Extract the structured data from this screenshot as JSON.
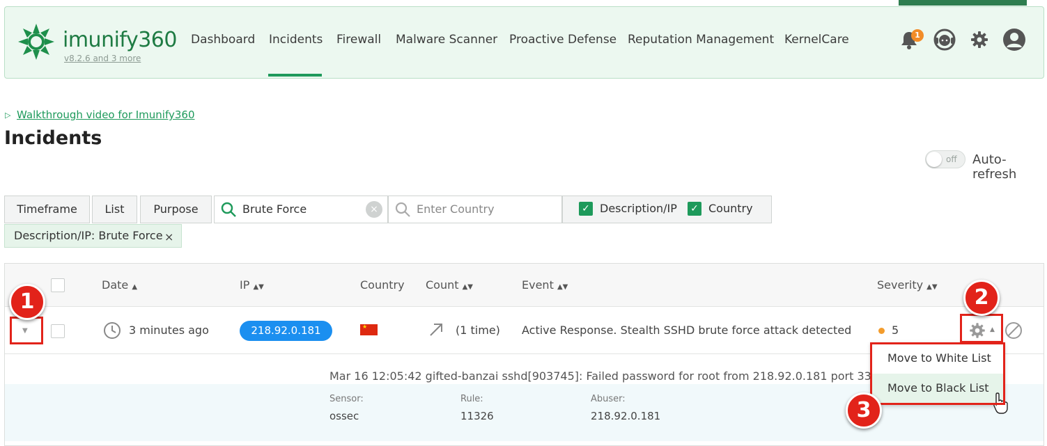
{
  "app": {
    "logo_text": "imunify360",
    "version_link": "v8.2.6 and 3 more"
  },
  "nav": {
    "items": [
      "Dashboard",
      "Incidents",
      "Firewall",
      "Malware Scanner",
      "Proactive Defense",
      "Reputation Management",
      "KernelCare"
    ],
    "active": "Incidents"
  },
  "header_icons": {
    "notifications_count": "1"
  },
  "walkthrough": {
    "link_text": "Walkthrough video for Imunify360"
  },
  "page": {
    "title": "Incidents"
  },
  "auto_refresh": {
    "label": "Auto-refresh",
    "state_text": "off"
  },
  "filters": {
    "buttons": [
      "Timeframe",
      "List",
      "Purpose"
    ],
    "search_value": "Brute Force",
    "country_placeholder": "Enter Country",
    "check_labels": [
      "Description/IP",
      "Country"
    ],
    "active_chip": "Description/IP:  Brute Force",
    "chip_remove": "×"
  },
  "table": {
    "headers": {
      "date": "Date",
      "ip": "IP",
      "country": "Country",
      "count": "Count",
      "event": "Event",
      "severity": "Severity"
    },
    "rows": [
      {
        "date": "3 minutes ago",
        "ip": "218.92.0.181",
        "count": "(1 time)",
        "event": "Active Response. Stealth SSHD brute force attack detected",
        "severity": "5"
      }
    ],
    "detail": {
      "log": "Mar 16 12:05:42 gifted-banzai sshd[903745]: Failed password for root from 218.92.0.181 port 33817 ssh",
      "sensor_label": "Sensor:",
      "sensor": "ossec",
      "rule_label": "Rule:",
      "rule": "11326",
      "abuser_label": "Abuser:",
      "abuser": "218.92.0.181"
    }
  },
  "actions_menu": {
    "items": [
      "Move to White List",
      "Move to Black List"
    ]
  },
  "annotations": [
    "1",
    "2",
    "3"
  ],
  "colors": {
    "brand_green": "#1e9a5b",
    "ip_pill": "#1b8ff0",
    "annotation_red": "#e2231a",
    "severity_dot": "#f39c2c"
  }
}
